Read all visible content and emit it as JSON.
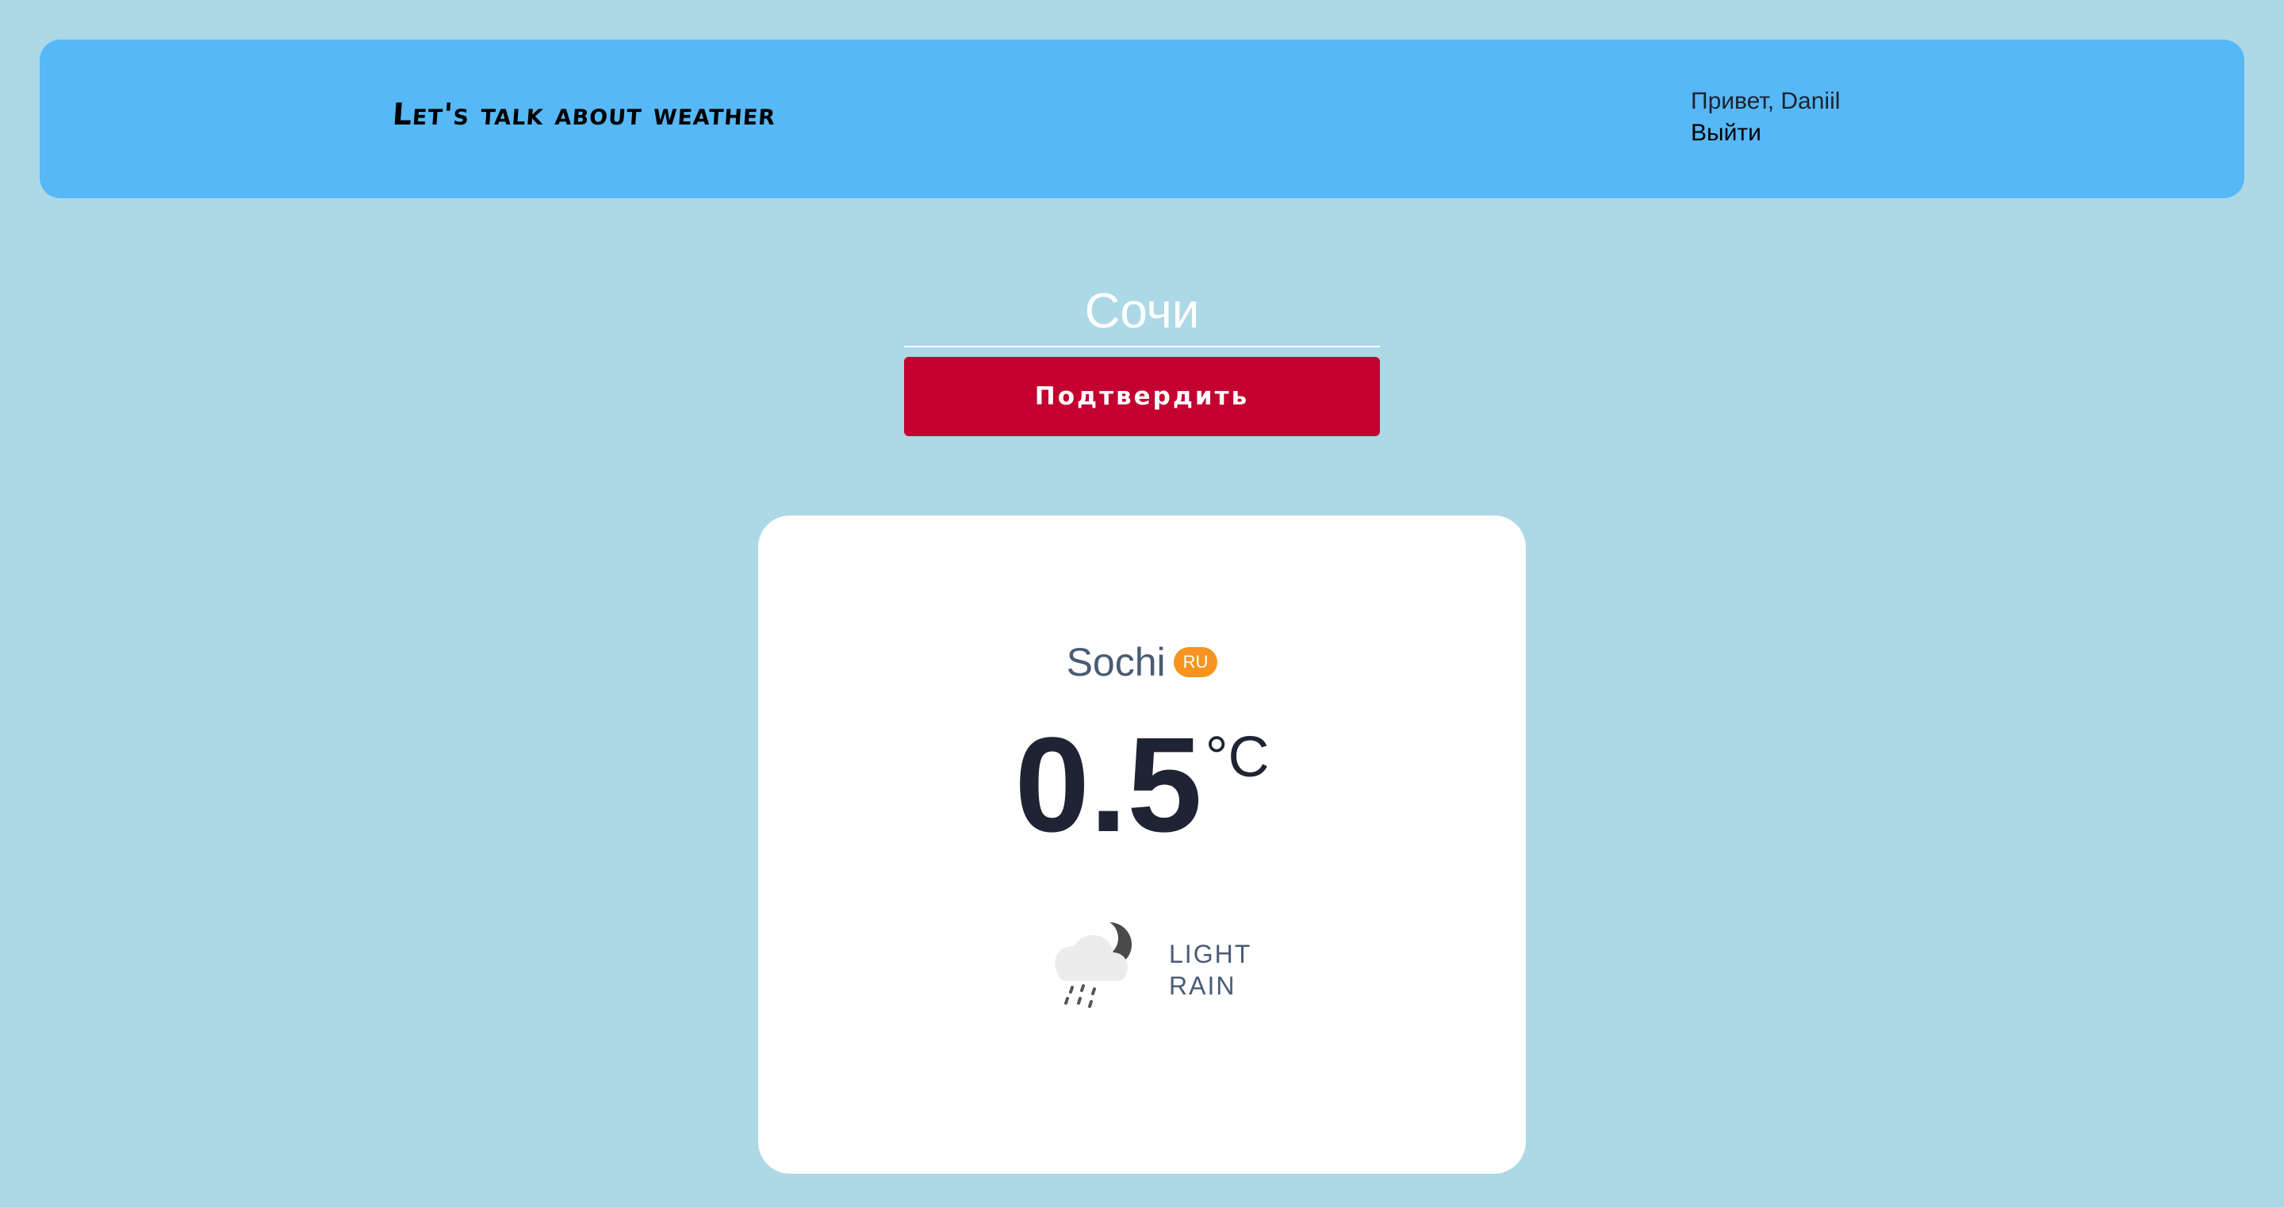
{
  "header": {
    "brand": "Let's talk about weather",
    "greeting": "Привет, Daniil",
    "logout_label": "Выйти"
  },
  "search": {
    "city_value": "Сочи",
    "confirm_label": "Подтвердить"
  },
  "weather": {
    "city": "Sochi",
    "country": "RU",
    "temperature": "0.5",
    "unit": "°C",
    "condition": "LIGHT RAIN",
    "icon": "cloud-moon-rain-icon"
  },
  "colors": {
    "background": "#add8e6",
    "header": "#56b8f6",
    "accent_button": "#c3002f",
    "badge": "#f7931e"
  }
}
